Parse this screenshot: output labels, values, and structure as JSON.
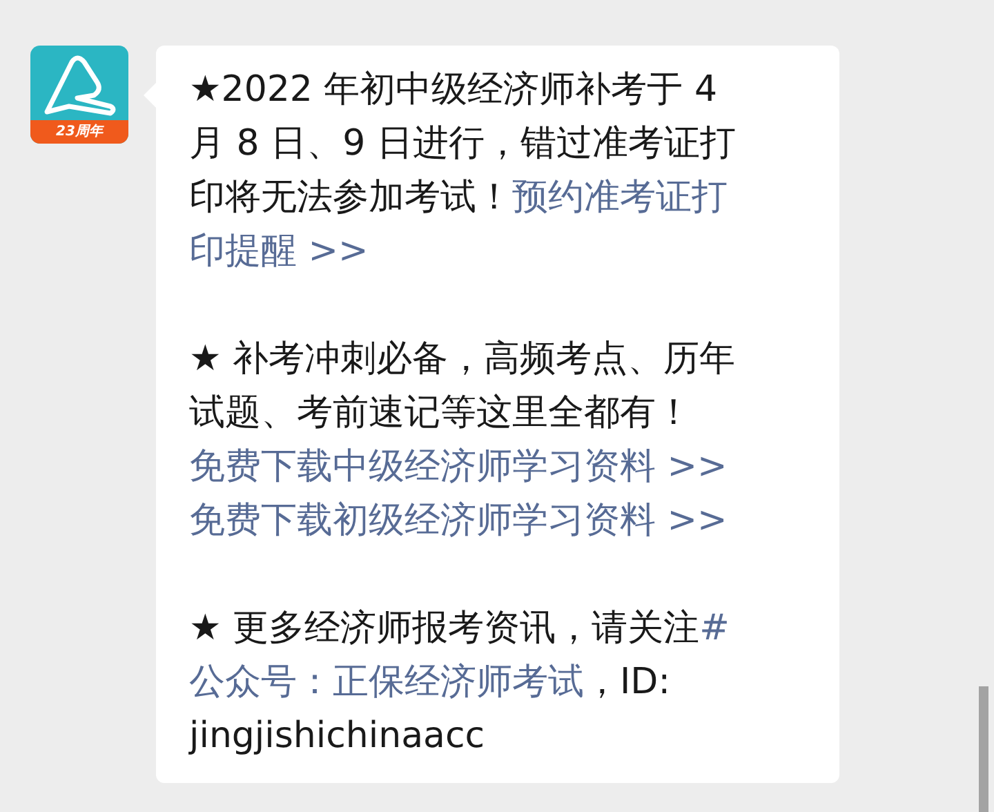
{
  "message": {
    "avatar": {
      "badge": "23周年"
    },
    "paragraphs": [
      {
        "lines": [
          [
            {
              "kind": "text",
              "text": "★2022 年初中级经济师补考于 4"
            }
          ],
          [
            {
              "kind": "text",
              "text": "月 8 日、9 日进行，错过准考证打"
            }
          ],
          [
            {
              "kind": "text",
              "text": "印将无法参加考试！"
            },
            {
              "kind": "link",
              "text": "预约准考证打"
            }
          ],
          [
            {
              "kind": "link",
              "text": "印提醒 >>"
            }
          ]
        ]
      },
      {
        "lines": [
          [
            {
              "kind": "text",
              "text": "★ 补考冲刺必备，高频考点、历年"
            }
          ],
          [
            {
              "kind": "text",
              "text": "试题、考前速记等这里全都有！"
            }
          ],
          [
            {
              "kind": "link",
              "text": "免费下载中级经济师学习资料 >>"
            }
          ],
          [
            {
              "kind": "link",
              "text": "免费下载初级经济师学习资料 >>"
            }
          ]
        ]
      },
      {
        "lines": [
          [
            {
              "kind": "text",
              "text": "★ 更多经济师报考资讯，请关注"
            },
            {
              "kind": "link",
              "text": "#"
            }
          ],
          [
            {
              "kind": "link",
              "text": "公众号：正保经济师考试"
            },
            {
              "kind": "text",
              "text": "，ID:"
            }
          ],
          [
            {
              "kind": "text",
              "text": "jingjishichinaacc"
            }
          ]
        ]
      }
    ]
  }
}
